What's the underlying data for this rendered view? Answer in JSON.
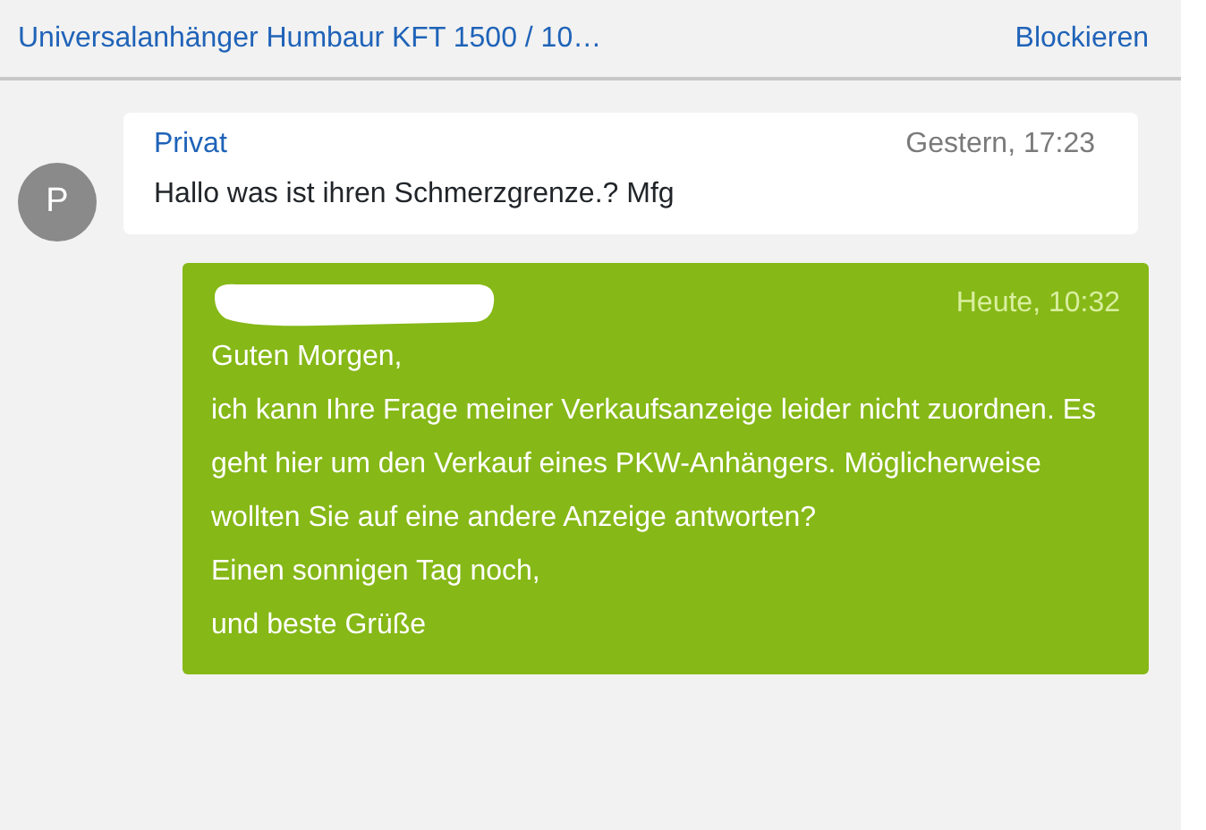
{
  "header": {
    "title": "Universalanhänger Humbaur KFT 1500 / 10…",
    "action": "Blockieren"
  },
  "messages": [
    {
      "kind": "received",
      "avatar": "P",
      "sender": "Privat",
      "time": "Gestern, 17:23",
      "lines": [
        "Hallo was ist ihren Schmerzgrenze.? Mfg"
      ]
    },
    {
      "kind": "sent",
      "time": "Heute, 10:32",
      "lines": [
        "Guten Morgen,",
        "ich kann Ihre Frage meiner Verkaufsanzeige leider nicht zuordnen. Es geht hier um den Verkauf eines PKW-Anhängers. Möglicherweise wollten Sie auf eine andere Anzeige antworten?",
        "Einen sonnigen Tag noch,",
        "und beste Grüße"
      ]
    }
  ]
}
